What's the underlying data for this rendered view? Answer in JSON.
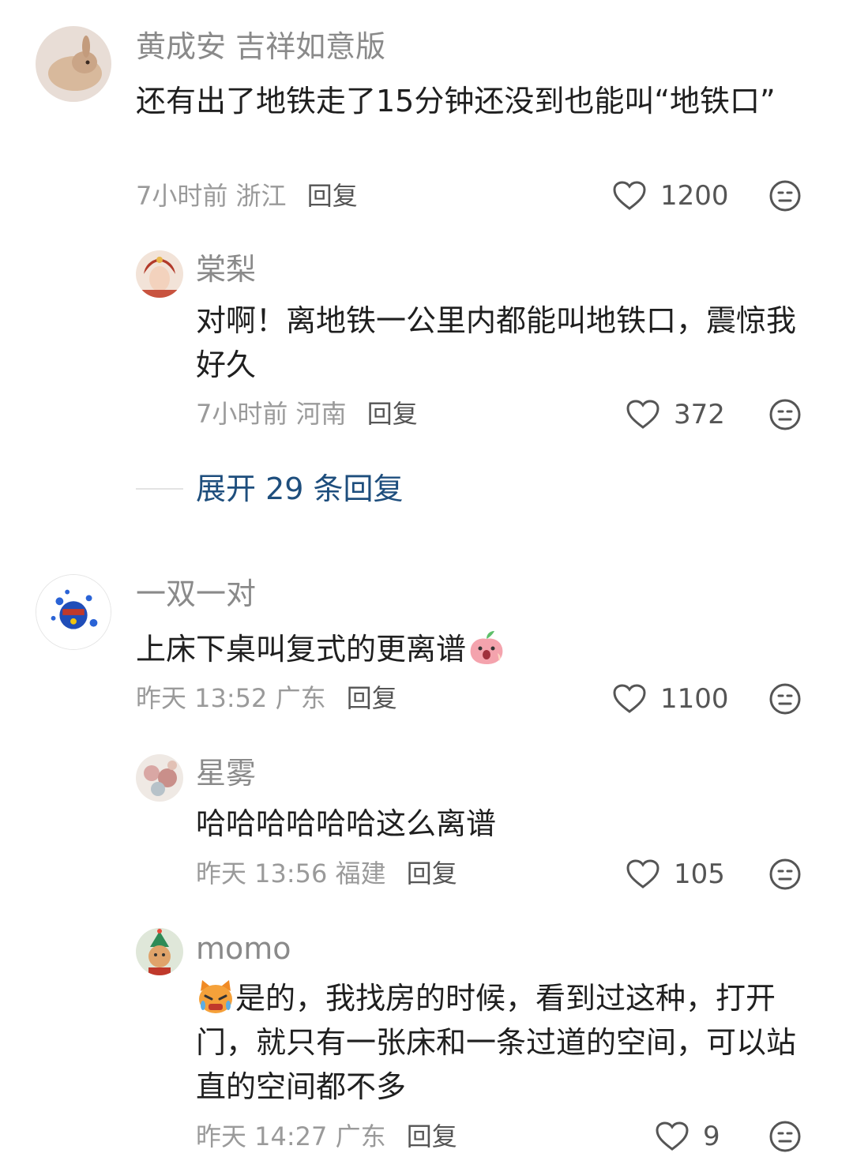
{
  "comments": [
    {
      "author": "黄成安 吉祥如意版",
      "text": "还有出了地铁走了15分钟还没到也能叫“地铁口”",
      "time": "7小时前",
      "location": "浙江",
      "reply_label": "回复",
      "likes": "1200",
      "replies": [
        {
          "author": "棠梨",
          "text": "对啊！离地铁一公里内都能叫地铁口，震惊我好久",
          "time": "7小时前",
          "location": "河南",
          "reply_label": "回复",
          "likes": "372"
        }
      ],
      "expand_label": "展开 29 条回复"
    },
    {
      "author": "一双一对",
      "text": "上床下桌叫复式的更离谱",
      "time": "昨天 13:52",
      "location": "广东",
      "reply_label": "回复",
      "likes": "1100",
      "replies": [
        {
          "author": "星雾",
          "text": "哈哈哈哈哈哈这么离谱",
          "time": "昨天 13:56",
          "location": "福建",
          "reply_label": "回复",
          "likes": "105"
        },
        {
          "author": "momo",
          "text": "是的，我找房的时候，看到过这种，打开门，就只有一张床和一条过道的空间，可以站直的空间都不多",
          "time": "昨天 14:27",
          "location": "广东",
          "reply_label": "回复",
          "likes": "9"
        }
      ]
    }
  ],
  "icons": {
    "like": "heart-outline-icon",
    "dislike": "meh-face-icon"
  },
  "colors": {
    "expand_link": "#1e4e7d",
    "meta": "#9a9a9a",
    "name": "#8a8a8a"
  }
}
